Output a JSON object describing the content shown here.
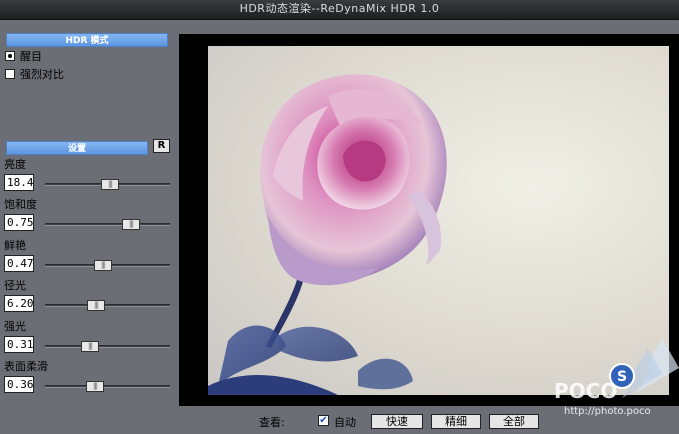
{
  "window": {
    "title": "HDR动态渲染--ReDynaMix HDR 1.0"
  },
  "mode_section": {
    "header": "HDR 模式",
    "options": [
      {
        "label": "醒目",
        "selected": true
      },
      {
        "label": "强烈对比",
        "selected": false
      }
    ]
  },
  "settings_section": {
    "header": "设置",
    "reset_label": "R",
    "params": [
      {
        "label": "亮度",
        "value": "18.4",
        "slider": 0.52
      },
      {
        "label": "饱和度",
        "value": "0.75",
        "slider": 0.72
      },
      {
        "label": "鲜艳",
        "value": "0.47",
        "slider": 0.46
      },
      {
        "label": "径光",
        "value": "6.20",
        "slider": 0.39
      },
      {
        "label": "强光",
        "value": "0.31",
        "slider": 0.34
      },
      {
        "label": "表面柔滑",
        "value": "0.36",
        "slider": 0.38
      }
    ]
  },
  "bottom": {
    "view_label": "查看:",
    "auto_label": "自动",
    "auto_checked": true,
    "buttons": [
      "快速",
      "精细",
      "全部"
    ]
  },
  "watermark": {
    "text": "POCO",
    "url_text": "http://photo.poco"
  }
}
